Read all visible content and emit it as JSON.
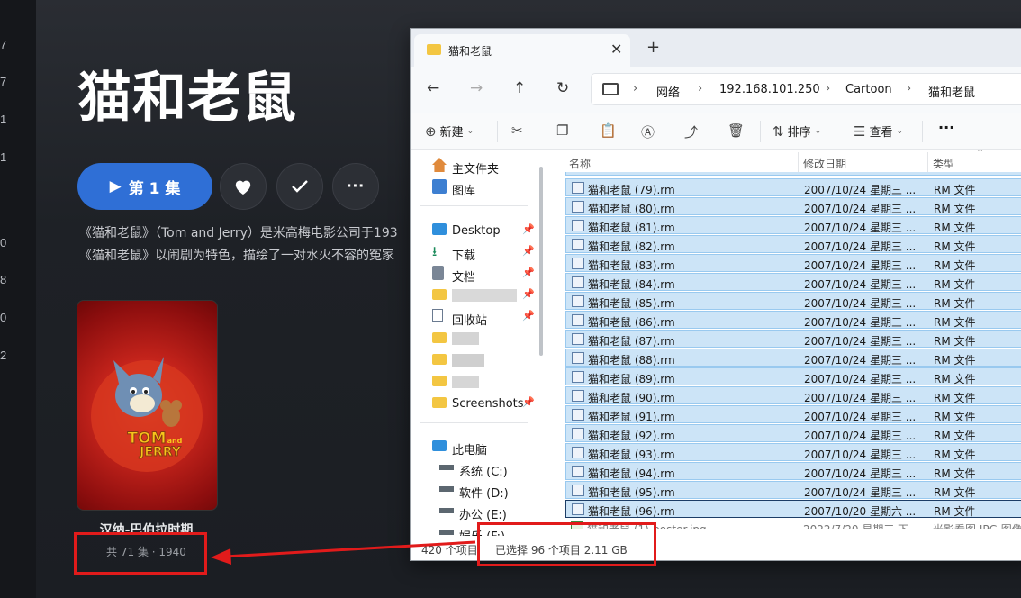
{
  "left_strip_numbers": [
    "7",
    "7",
    "7",
    "1",
    "1",
    "0",
    "8",
    "0",
    "2"
  ],
  "media": {
    "title": "猫和老鼠",
    "play_label": "第 1 集",
    "desc_line1": "《猫和老鼠》（Tom and Jerry）是米高梅电影公司于193",
    "desc_line2": "《猫和老鼠》以闹剧为特色，描绘了一对水火不容的冤家",
    "poster_logo": "TOM and JERRY",
    "poster_name": "汉纳-巴伯拉时期",
    "poster_meta": "共 71 集 · 1940"
  },
  "explorer": {
    "tab_title": "猫和老鼠",
    "breadcrumb": [
      "网络",
      "192.168.101.250",
      "Cartoon",
      "猫和老鼠"
    ],
    "toolbar": {
      "new": "新建",
      "sort": "排序",
      "view": "查看",
      "more": "···"
    },
    "nav": {
      "home": "主文件夹",
      "gallery": "图库",
      "desktop": "Desktop",
      "downloads": "下载",
      "documents": "文档",
      "recycle": "回收站",
      "screenshots": "Screenshots",
      "this_pc": "此电脑",
      "drive_c": "系统 (C:)",
      "drive_d": "软件 (D:)",
      "drive_e": "办公 (E:)",
      "drive_f": "娱乐 (F:)"
    },
    "columns": {
      "name": "名称",
      "date": "修改日期",
      "type": "类型"
    },
    "files": [
      {
        "name": "猫和老鼠 (79).rm",
        "date": "2007/10/24 星期三 ...",
        "type": "RM 文件"
      },
      {
        "name": "猫和老鼠 (80).rm",
        "date": "2007/10/24 星期三 ...",
        "type": "RM 文件"
      },
      {
        "name": "猫和老鼠 (81).rm",
        "date": "2007/10/24 星期三 ...",
        "type": "RM 文件"
      },
      {
        "name": "猫和老鼠 (82).rm",
        "date": "2007/10/24 星期三 ...",
        "type": "RM 文件"
      },
      {
        "name": "猫和老鼠 (83).rm",
        "date": "2007/10/24 星期三 ...",
        "type": "RM 文件"
      },
      {
        "name": "猫和老鼠 (84).rm",
        "date": "2007/10/24 星期三 ...",
        "type": "RM 文件"
      },
      {
        "name": "猫和老鼠 (85).rm",
        "date": "2007/10/24 星期三 ...",
        "type": "RM 文件"
      },
      {
        "name": "猫和老鼠 (86).rm",
        "date": "2007/10/24 星期三 ...",
        "type": "RM 文件"
      },
      {
        "name": "猫和老鼠 (87).rm",
        "date": "2007/10/24 星期三 ...",
        "type": "RM 文件"
      },
      {
        "name": "猫和老鼠 (88).rm",
        "date": "2007/10/24 星期三 ...",
        "type": "RM 文件"
      },
      {
        "name": "猫和老鼠 (89).rm",
        "date": "2007/10/24 星期三 ...",
        "type": "RM 文件"
      },
      {
        "name": "猫和老鼠 (90).rm",
        "date": "2007/10/24 星期三 ...",
        "type": "RM 文件"
      },
      {
        "name": "猫和老鼠 (91).rm",
        "date": "2007/10/24 星期三 ...",
        "type": "RM 文件"
      },
      {
        "name": "猫和老鼠 (92).rm",
        "date": "2007/10/24 星期三 ...",
        "type": "RM 文件"
      },
      {
        "name": "猫和老鼠 (93).rm",
        "date": "2007/10/24 星期三 ...",
        "type": "RM 文件"
      },
      {
        "name": "猫和老鼠 (94).rm",
        "date": "2007/10/24 星期三 ...",
        "type": "RM 文件"
      },
      {
        "name": "猫和老鼠 (95).rm",
        "date": "2007/10/24 星期三 ...",
        "type": "RM 文件"
      },
      {
        "name": "猫和老鼠 (96).rm",
        "date": "2007/10/20 星期六 ...",
        "type": "RM 文件"
      },
      {
        "name": "猫和老鼠 (1)-poster.jpg",
        "date": "2022/7/20 星期三 下...",
        "type": "光影看图 JPG 图像"
      }
    ],
    "status_count": "420 个项目",
    "status_selected": "已选择 96 个项目  2.11 GB"
  }
}
